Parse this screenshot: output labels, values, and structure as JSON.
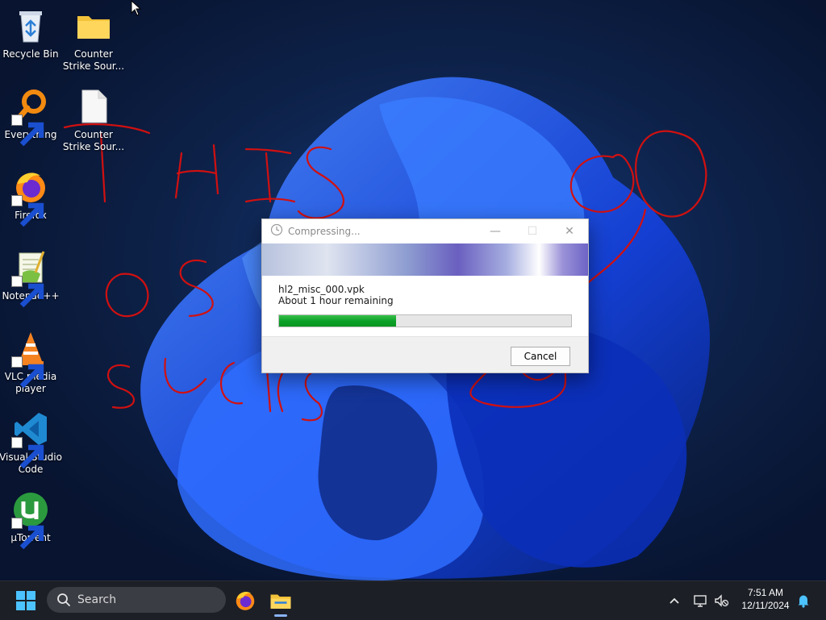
{
  "desktop": {
    "icons": [
      {
        "label": "Recycle Bin",
        "icon": "recycle-bin-icon"
      },
      {
        "label": "Counter Strike Sour...",
        "icon": "folder-icon"
      },
      {
        "label": "Everything",
        "icon": "everything-search-icon"
      },
      {
        "label": "Counter Strike Sour...",
        "icon": "file-icon"
      },
      {
        "label": "Firefox",
        "icon": "firefox-icon"
      },
      {
        "label": "Notepad++",
        "icon": "notepad-plus-plus-icon"
      },
      {
        "label": "VLC media player",
        "icon": "vlc-icon"
      },
      {
        "label": "Visual Studio Code",
        "icon": "vscode-icon"
      },
      {
        "label": "µTorrent",
        "icon": "utorrent-icon"
      }
    ]
  },
  "dialog": {
    "title": "Compressing...",
    "file_name": "hl2_misc_000.vpk",
    "time_remaining": "About 1 hour remaining",
    "progress_fraction": 0.4,
    "cancel_label": "Cancel",
    "minimize": "—",
    "maximize": "☐",
    "close": "✕"
  },
  "taskbar": {
    "search_label": "Search",
    "time": "7:51 AM",
    "date": "12/11/2024",
    "pinned_apps": [
      "firefox-icon",
      "file-explorer-icon"
    ],
    "tray": [
      "chevron-up-icon",
      "network-icon",
      "volume-muted-icon",
      "notification-bell-icon"
    ]
  },
  "colors": {
    "accent_blue": "#1f5fff",
    "progress_green": "#0ea22a",
    "scribble_red": "#d11010",
    "taskbar_bg": "#1c1f26"
  }
}
